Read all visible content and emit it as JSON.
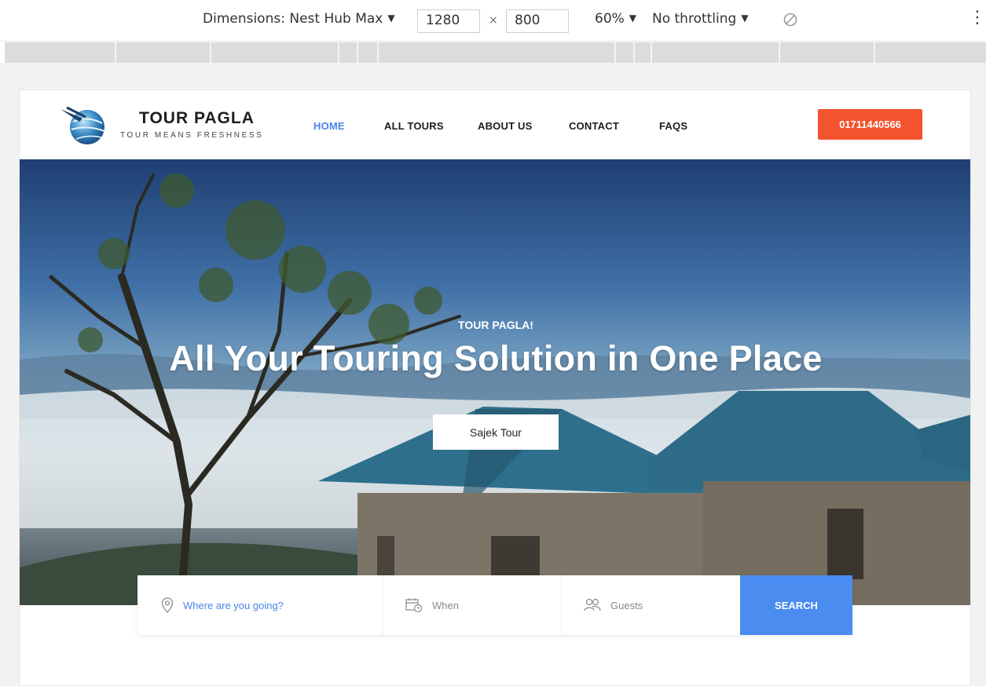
{
  "devtools": {
    "dimensions_label": "Dimensions: Nest Hub Max",
    "width": "1280",
    "height": "800",
    "times": "×",
    "zoom": "60%",
    "throttling": "No throttling",
    "caret": "▼",
    "more": "⋮"
  },
  "site": {
    "brand": "TOUR PAGLA",
    "tagline": "TOUR MEANS FRESHNESS",
    "nav": [
      {
        "label": "HOME",
        "active": true
      },
      {
        "label": "ALL TOURS",
        "active": false
      },
      {
        "label": "ABOUT US",
        "active": false
      },
      {
        "label": "CONTACT",
        "active": false
      },
      {
        "label": "FAQS",
        "active": false
      }
    ],
    "phone": "01711440566"
  },
  "hero": {
    "kicker": "TOUR PAGLA!",
    "title": "All Your Touring Solution in One Place",
    "button": "Sajek Tour"
  },
  "search": {
    "destination_placeholder": "Where are you going?",
    "when_placeholder": "When",
    "guests_placeholder": "Guests",
    "button": "SEARCH"
  },
  "colors": {
    "accent_blue": "#4a86e8",
    "phone_button": "#f4532f",
    "search_button": "#4a8cf0"
  }
}
